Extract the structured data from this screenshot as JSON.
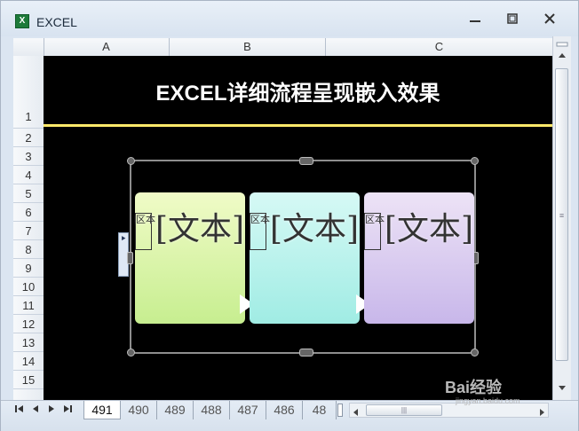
{
  "window": {
    "title": "EXCEL",
    "app_icon_glyph": "X"
  },
  "columns": [
    "A",
    "B",
    "C"
  ],
  "rows": [
    "1",
    "2",
    "3",
    "4",
    "5",
    "6",
    "7",
    "8",
    "9",
    "10",
    "11",
    "12",
    "13",
    "14",
    "15"
  ],
  "sheet": {
    "title": "EXCEL详细流程呈现嵌入效果",
    "accent_line_color": "#ffe96a"
  },
  "smartart": {
    "cards": [
      {
        "text": "[文本]",
        "bullet": "区本",
        "gradient_top": "#f0fbc7",
        "gradient_bottom": "#c7ee90"
      },
      {
        "text": "[文本]",
        "bullet": "区本",
        "gradient_top": "#d6f9f5",
        "gradient_bottom": "#a0ece4"
      },
      {
        "text": "[文本]",
        "bullet": "区本",
        "gradient_top": "#ede3f6",
        "gradient_bottom": "#c8b7ea"
      }
    ],
    "textpane_tab_glyph": "⯈"
  },
  "sheet_tabs": [
    "491",
    "490",
    "489",
    "488",
    "487",
    "486",
    "48"
  ],
  "active_tab": "491",
  "watermark": {
    "text": "Bai经验",
    "sub": "jingyan.baidu.com"
  }
}
